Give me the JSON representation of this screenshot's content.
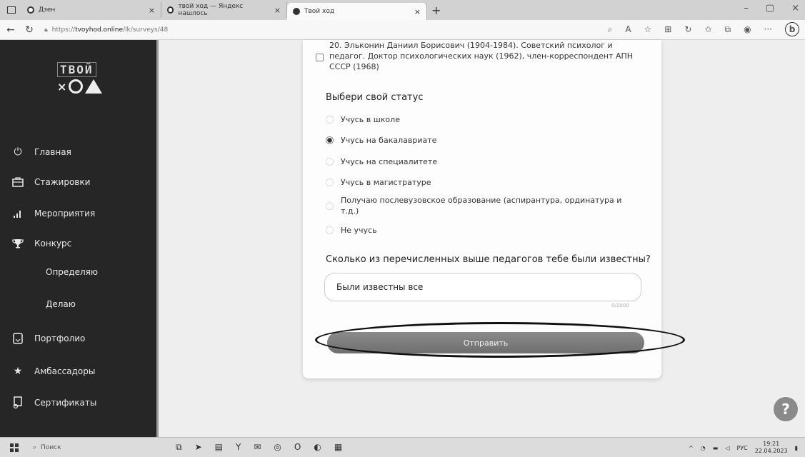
{
  "browser": {
    "tabs": [
      {
        "label": "Дзен",
        "close": "×"
      },
      {
        "label": "твой ход — Яндекс нашлось",
        "close": "×"
      },
      {
        "label": "Твой ход",
        "close": "×"
      }
    ],
    "new_tab": "+",
    "url_prefix": "https://",
    "url_host": "tvoyhod.online",
    "url_path": "/lk/surveys/48",
    "win_controls": [
      "–",
      "▢",
      "×"
    ]
  },
  "sidebar": {
    "logo_top": "ТВОЙ",
    "logo_x": "×",
    "items": [
      {
        "label": "Главная",
        "icon": "power-icon"
      },
      {
        "label": "Стажировки",
        "icon": "briefcase-icon"
      },
      {
        "label": "Мероприятия",
        "icon": "bars-icon"
      },
      {
        "label": "Конкурс",
        "icon": "trophy-icon"
      },
      {
        "label": "Определяю",
        "icon": ""
      },
      {
        "label": "Делаю",
        "icon": ""
      },
      {
        "label": "Портфолио",
        "icon": "portfolio-icon"
      },
      {
        "label": "Амбассадоры",
        "icon": "star-icon"
      },
      {
        "label": "Сертификаты",
        "icon": "certificate-icon"
      }
    ]
  },
  "survey": {
    "teacher_option": "20. Эльконин Даниил Борисович (1904-1984). Советский психолог и педагог. Доктор психологических наук (1962), член-корреспондент АПН СССР (1968)",
    "status_title": "Выбери свой статус",
    "status_options": [
      {
        "label": "Учусь в школе",
        "selected": false
      },
      {
        "label": "Учусь на бакалавриате",
        "selected": true
      },
      {
        "label": "Учусь на специалитете",
        "selected": false
      },
      {
        "label": "Учусь в магистратуре",
        "selected": false
      },
      {
        "label": "Получаю послевузовское образование (аспирантура, ординатура и т.д.)",
        "selected": false
      },
      {
        "label": "Не учусь",
        "selected": false
      }
    ],
    "known_title": "Сколько из перечисленных выше педагогов тебе были известны?",
    "known_answer": "Были известны все",
    "counter": "0/1000",
    "submit_label": "Отправить"
  },
  "help_label": "?",
  "taskbar": {
    "search_label": "Поиск",
    "lang": "РУС",
    "time": "19:21",
    "date": "22.04.2023"
  }
}
